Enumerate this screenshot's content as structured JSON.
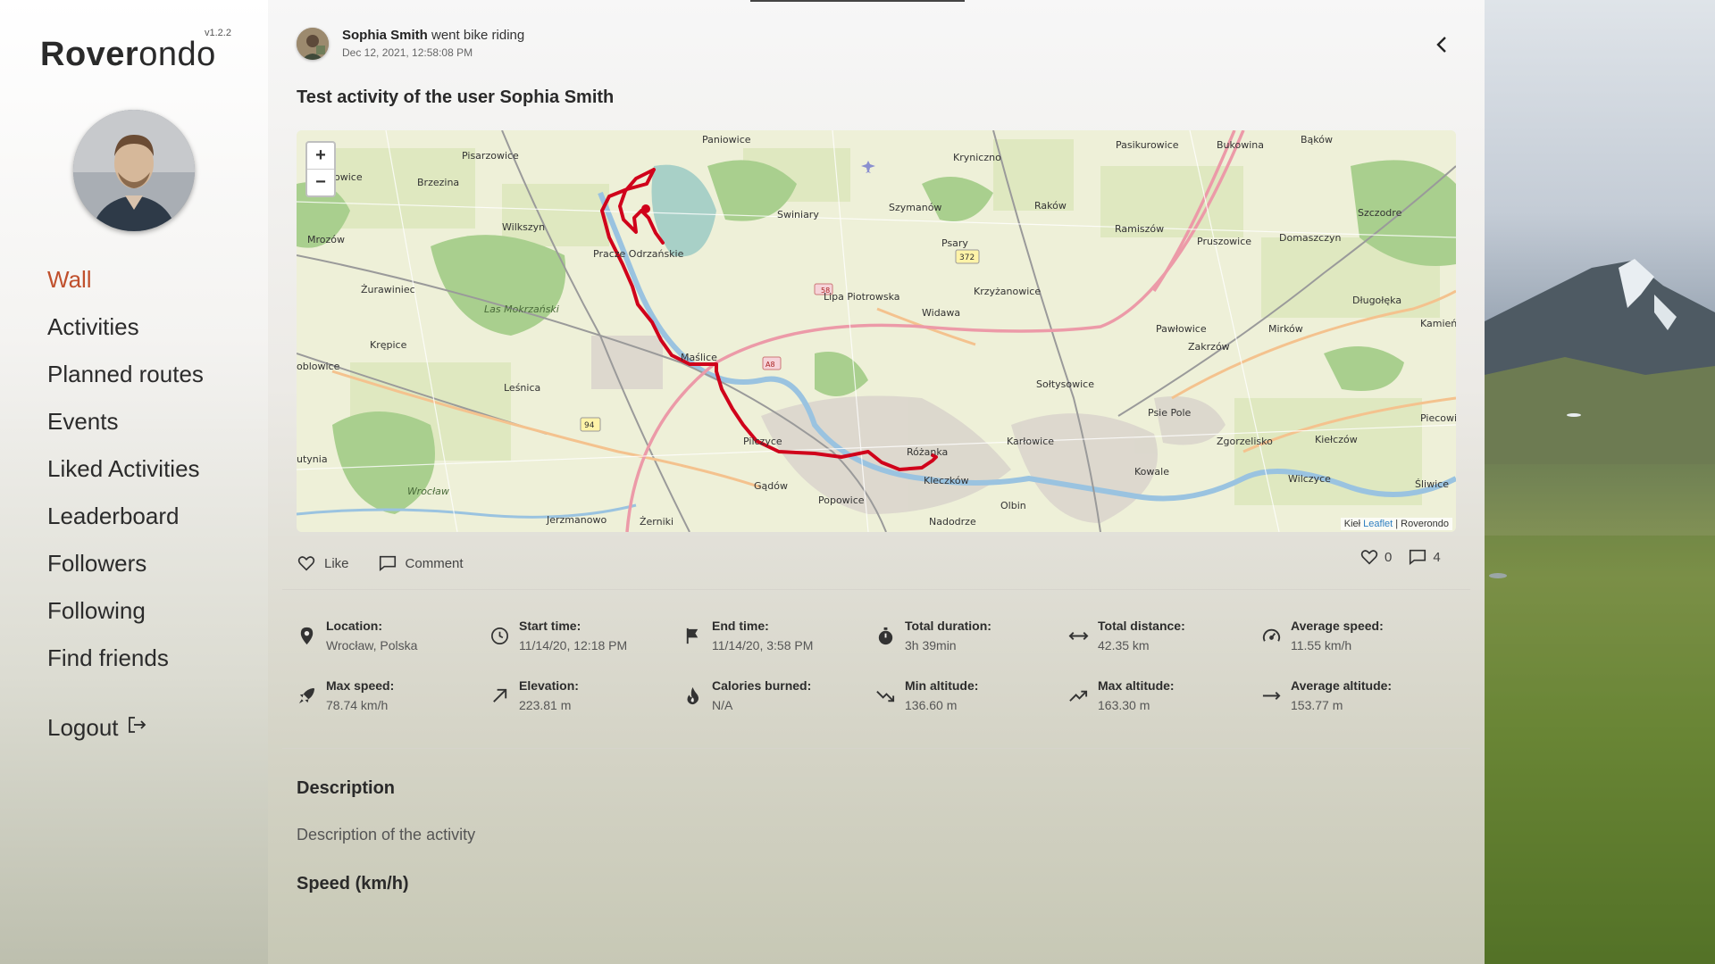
{
  "app": {
    "name_bold": "Rover",
    "name_rest": "ondo",
    "version": "v1.2.2"
  },
  "sidebar": {
    "items": [
      {
        "label": "Wall",
        "active": true
      },
      {
        "label": "Activities"
      },
      {
        "label": "Planned routes"
      },
      {
        "label": "Events"
      },
      {
        "label": "Liked Activities"
      },
      {
        "label": "Leaderboard"
      },
      {
        "label": "Followers"
      },
      {
        "label": "Following"
      },
      {
        "label": "Find friends"
      }
    ],
    "logout_label": "Logout"
  },
  "post": {
    "user_name": "Sophia Smith",
    "action": " went bike riding",
    "date": "Dec 12, 2021, 12:58:08 PM",
    "title": "Test activity of the user Sophia Smith",
    "like_label": "Like",
    "comment_label": "Comment",
    "likes_count": "0",
    "comments_count": "4"
  },
  "map": {
    "zoom_in": "+",
    "zoom_out": "−",
    "attribution_link": "Leaflet",
    "attribution_rest": " | Roverondo",
    "attribution_prefix": "Kieł",
    "route_color": "#d0021b",
    "places": [
      "Paniowice",
      "Kryniczno",
      "Pasikurowice",
      "Bukowina",
      "Bąków",
      "Pisarzowice",
      "Brzezina",
      "Swiniary",
      "Szymanów",
      "Raków",
      "Ramiszów",
      "Pruszowice",
      "Domaszczyn",
      "Szczodre",
      "Wilkszyn",
      "Psary",
      "Mrozów",
      "Pracze Odrzańskie",
      "Lipa Piotrowska",
      "Krzyżanowice",
      "Długołęka",
      "Żurawiniec",
      "Las Mokrzański",
      "Widawa",
      "Pawłowice",
      "Mirków",
      "Kamień",
      "Krępice",
      "Maślice",
      "Zakrzów",
      "Sołtysowice",
      "Leśnica",
      "Psie Pole",
      "Piecowice",
      "Pilczyce",
      "Różanka",
      "Karłowice",
      "Zgorzelisko",
      "Kiełczów",
      "Kowale",
      "Kleczków",
      "Gądów",
      "Popowice",
      "Wilczyce",
      "Śliwice",
      "Olbin",
      "Jerzmanowo",
      "Żerniki",
      "Nadodrze",
      "Wrocław",
      "owice",
      "oblowice",
      "utynia",
      "372",
      "58",
      "A8",
      "94"
    ]
  },
  "stats": [
    {
      "icon": "location-pin-icon",
      "label": "Location:",
      "value": "Wrocław, Polska"
    },
    {
      "icon": "clock-icon",
      "label": "Start time:",
      "value": "11/14/20, 12:18 PM"
    },
    {
      "icon": "flag-icon",
      "label": "End time:",
      "value": "11/14/20, 3:58 PM"
    },
    {
      "icon": "stopwatch-icon",
      "label": "Total duration:",
      "value": "3h 39min"
    },
    {
      "icon": "distance-arrows-icon",
      "label": "Total distance:",
      "value": "42.35 km"
    },
    {
      "icon": "speedometer-icon",
      "label": "Average speed:",
      "value": "11.55 km/h"
    },
    {
      "icon": "rocket-icon",
      "label": "Max speed:",
      "value": "78.74 km/h"
    },
    {
      "icon": "elevation-arrow-icon",
      "label": "Elevation:",
      "value": "223.81 m"
    },
    {
      "icon": "fire-icon",
      "label": "Calories burned:",
      "value": "N/A"
    },
    {
      "icon": "trend-down-icon",
      "label": "Min altitude:",
      "value": "136.60 m"
    },
    {
      "icon": "trend-up-icon",
      "label": "Max altitude:",
      "value": "163.30 m"
    },
    {
      "icon": "arrow-right-icon",
      "label": "Average altitude:",
      "value": "153.77 m"
    }
  ],
  "description": {
    "title": "Description",
    "text": "Description of the activity"
  },
  "speed_chart": {
    "title": "Speed (km/h)"
  },
  "colors": {
    "accent": "#c0502d"
  }
}
